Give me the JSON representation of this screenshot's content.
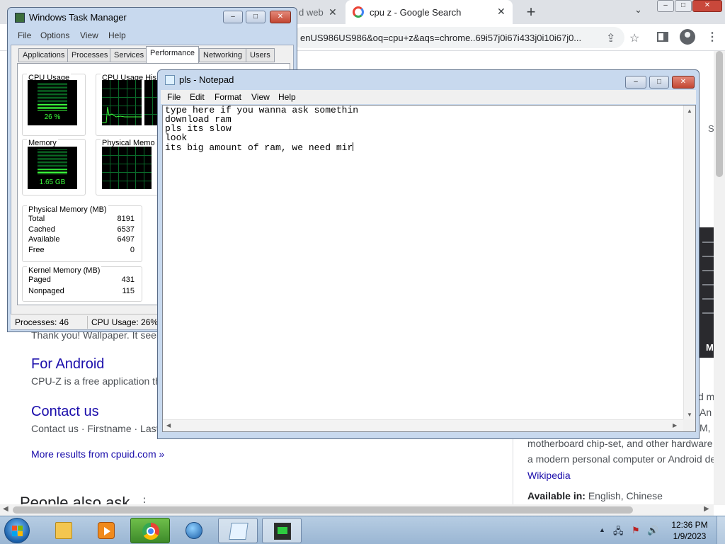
{
  "chrome": {
    "tabs": [
      {
        "title": "d web",
        "state": "inactive"
      },
      {
        "title": "cpu z - Google Search",
        "state": "active"
      }
    ],
    "new_tab": "+",
    "tab_close": "✕",
    "tab_dropdown": "⌄",
    "window_controls": {
      "min": "–",
      "max": "□",
      "close": "✕"
    },
    "url": "enUS986US986&oq=cpu+z&aqs=chrome..69i57j0i67i433j0i10i67j0...",
    "icons": [
      "share-icon",
      "star-icon",
      "side-panel-icon",
      "profile-icon",
      "menu-icon"
    ]
  },
  "search_page": {
    "snippet_top": "Thank you! Wallpaper. It seem",
    "results": [
      {
        "title": "For Android",
        "snippet": "CPU-Z is a free application th"
      },
      {
        "title": "Contact us",
        "snippet": "Contact us · Firstname · Last"
      }
    ],
    "more_results": "More results from cpuid.com »",
    "people_also_ask": "People also ask",
    "people_also_ask_menu": "⋮",
    "side_s": "S",
    "knowledge_panel": {
      "lines": [
        "d m",
        "An",
        "M,",
        "motherboard chip-set, and other hardware",
        "a modern personal computer or Android de"
      ],
      "wikipedia": "Wikipedia",
      "available_label": "Available in:",
      "available_value": " English, Chinese",
      "thumb_letter": "M"
    }
  },
  "task_manager": {
    "title": "Windows Task Manager",
    "menu": [
      "File",
      "Options",
      "View",
      "Help"
    ],
    "tabs": [
      "Applications",
      "Processes",
      "Services",
      "Performance",
      "Networking",
      "Users"
    ],
    "active_tab": "Performance",
    "cpu_usage": {
      "label": "CPU Usage",
      "value": "26 %",
      "level": 0.26
    },
    "cpu_history_label": "CPU Usage His",
    "memory": {
      "label": "Memory",
      "value": "1.65 GB",
      "level": 0.2
    },
    "physical_memory_history_label": "Physical Memo",
    "physical_memory": {
      "label": "Physical Memory (MB)",
      "rows": [
        {
          "name": "Total",
          "value": "8191"
        },
        {
          "name": "Cached",
          "value": "6537"
        },
        {
          "name": "Available",
          "value": "6497"
        },
        {
          "name": "Free",
          "value": "0"
        }
      ]
    },
    "kernel_memory": {
      "label": "Kernel Memory (MB)",
      "rows": [
        {
          "name": "Paged",
          "value": "431"
        },
        {
          "name": "Nonpaged",
          "value": "115"
        }
      ]
    },
    "status": {
      "processes": "Processes: 46",
      "cpu": "CPU Usage: 26%"
    },
    "window_controls": {
      "min": "–",
      "max": "□",
      "close": "✕"
    }
  },
  "notepad": {
    "title": "pls - Notepad",
    "menu": [
      "File",
      "Edit",
      "Format",
      "View",
      "Help"
    ],
    "lines": [
      "type here if you wanna ask somethin",
      "download ram",
      "pls its slow",
      "look",
      "its big amount of ram, we need mir"
    ],
    "window_controls": {
      "min": "–",
      "max": "□",
      "close": "✕"
    },
    "scroll_arrows": {
      "up": "▲",
      "down": "▼",
      "left": "◀",
      "right": "▶"
    }
  },
  "taskbar": {
    "pinned": [
      "windows-explorer-icon",
      "media-player-icon",
      "chrome-icon",
      "internet-globe-icon",
      "notepad-icon",
      "task-manager-icon"
    ],
    "tray": {
      "arrow": "▲",
      "network": "🖧",
      "flag": "⚑",
      "volume": "🔊"
    },
    "time": "12:36 PM",
    "date": "1/9/2023"
  },
  "colors": {
    "accent": "#1a0dab",
    "meter_green": "#3cff3c",
    "win7_frame": "#c8d9ee",
    "close_red": "#c24632"
  }
}
